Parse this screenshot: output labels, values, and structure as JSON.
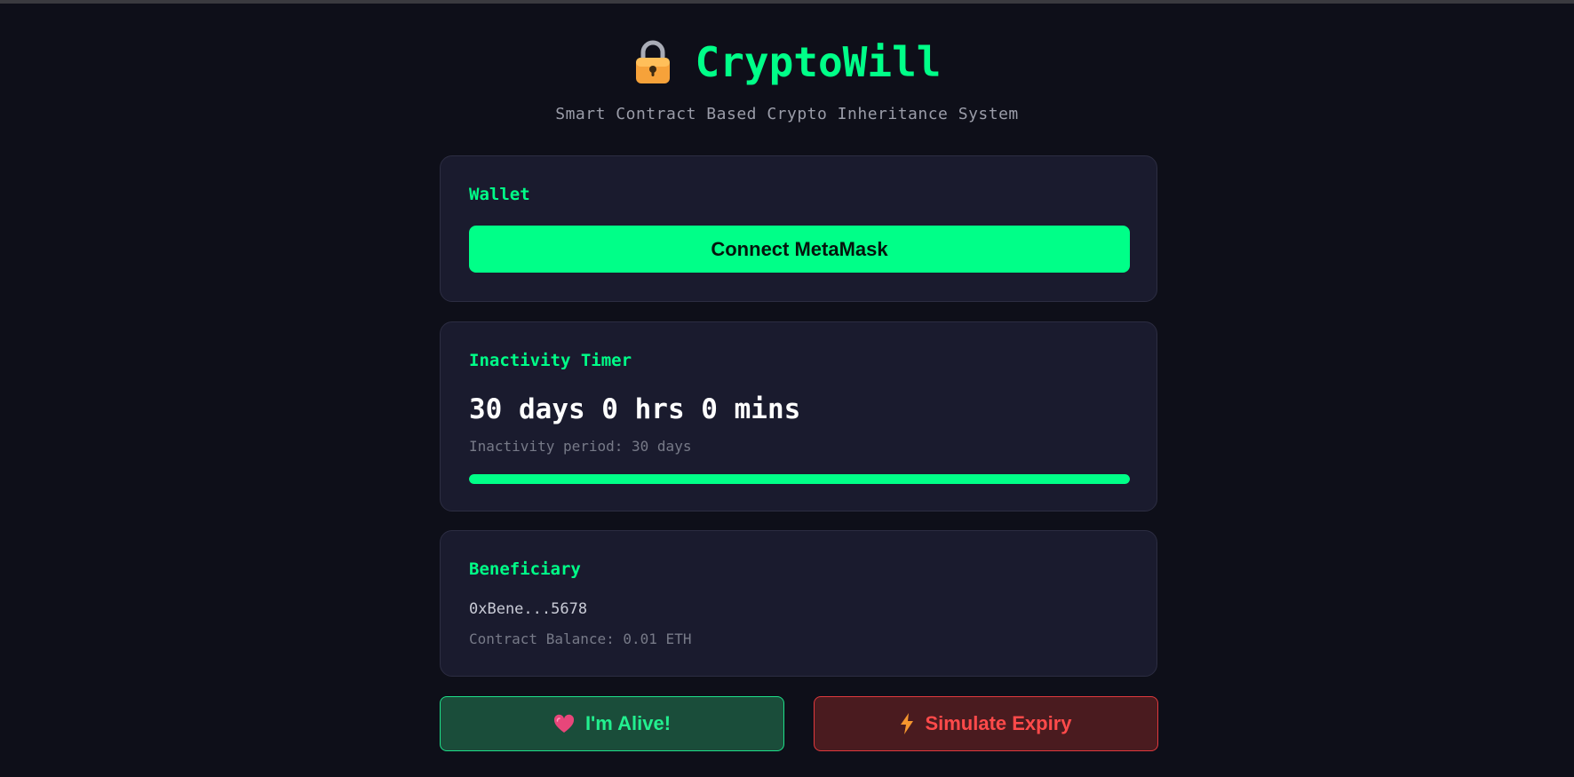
{
  "header": {
    "title": "CryptoWill",
    "subtitle": "Smart Contract Based Crypto Inheritance System",
    "icon": "lock-icon"
  },
  "wallet": {
    "title": "Wallet",
    "connect_label": "Connect MetaMask"
  },
  "timer": {
    "title": "Inactivity Timer",
    "remaining": "30 days 0 hrs 0 mins",
    "period": "Inactivity period: 30 days",
    "progress_percent": 100
  },
  "beneficiary": {
    "title": "Beneficiary",
    "address": "0xBene...5678",
    "balance": "Contract Balance: 0.01 ETH"
  },
  "actions": {
    "alive_label": "I'm Alive!",
    "alive_icon": "heart-icon",
    "expiry_label": "Simulate Expiry",
    "expiry_icon": "lightning-icon"
  },
  "colors": {
    "accent": "#00ff88",
    "danger": "#ff4a4a",
    "background": "#0e0f19",
    "card": "#1a1b2e"
  }
}
